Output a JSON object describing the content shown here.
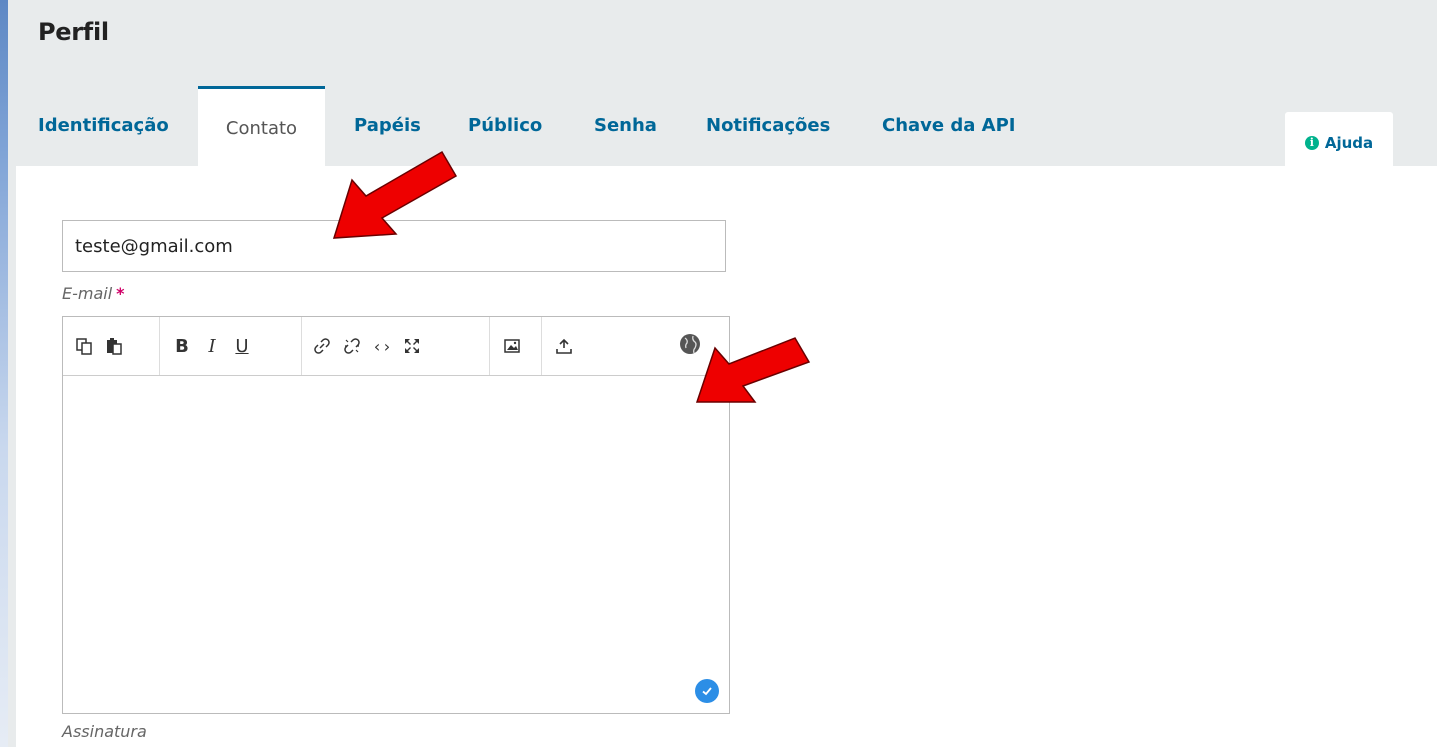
{
  "page": {
    "title": "Perfil"
  },
  "tabs": [
    {
      "label": "Identificação"
    },
    {
      "label": "Contato",
      "active": true
    },
    {
      "label": "Papéis"
    },
    {
      "label": "Público"
    },
    {
      "label": "Senha"
    },
    {
      "label": "Notificações"
    },
    {
      "label": "Chave da API"
    }
  ],
  "help": {
    "label": "Ajuda",
    "icon": "info-icon"
  },
  "form": {
    "email": {
      "value": "teste@gmail.com",
      "label": "E-mail",
      "required_mark": "*"
    },
    "signature": {
      "label": "Assinatura",
      "value": ""
    }
  },
  "toolbar_icons": [
    "copy-icon",
    "paste-icon",
    "bold-icon",
    "italic-icon",
    "underline-icon",
    "link-icon",
    "unlink-icon",
    "code-icon",
    "fullscreen-icon",
    "image-icon",
    "upload-icon",
    "globe-icon"
  ],
  "colors": {
    "accent": "#006798",
    "required": "#d00168",
    "help_icon": "#00b28d",
    "annotation_arrow": "#ee0000",
    "check_badge": "#2c8ee6"
  }
}
